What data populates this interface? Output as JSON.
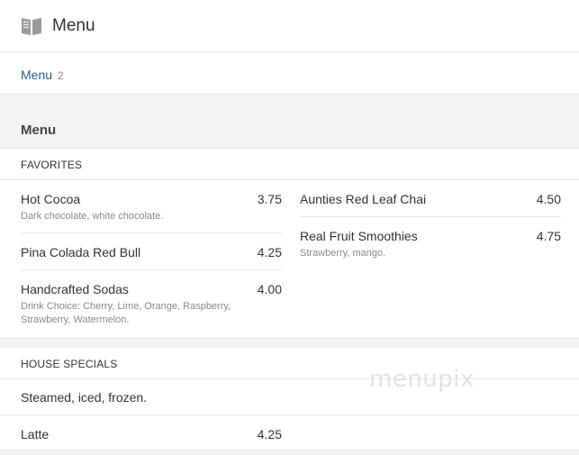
{
  "header": {
    "icon": "book-icon",
    "title": "Menu"
  },
  "tabs": [
    {
      "label": "Menu",
      "count": "2"
    }
  ],
  "section": {
    "title": "Menu"
  },
  "categories": [
    {
      "title": "FAVORITES",
      "left_items": [
        {
          "name": "Hot Cocoa",
          "price": "3.75",
          "desc": "Dark chocolate, white chocolate."
        },
        {
          "name": "Pina Colada Red Bull",
          "price": "4.25",
          "desc": ""
        },
        {
          "name": "Handcrafted Sodas",
          "price": "4.00",
          "desc": "Drink Choice: Cherry, Lime, Orange, Raspberry, Strawberry, Watermelon."
        }
      ],
      "right_items": [
        {
          "name": "Aunties Red Leaf Chai",
          "price": "4.50",
          "desc": ""
        },
        {
          "name": "Real Fruit Smoothies",
          "price": "4.75",
          "desc": "Strawberry, mango."
        }
      ]
    },
    {
      "title": "HOUSE SPECIALS",
      "left_items": [
        {
          "name": "Steamed, iced, frozen.",
          "price": "",
          "desc": ""
        },
        {
          "name": "Latte",
          "price": "4.25",
          "desc": ""
        }
      ]
    }
  ],
  "watermark": "menupix"
}
